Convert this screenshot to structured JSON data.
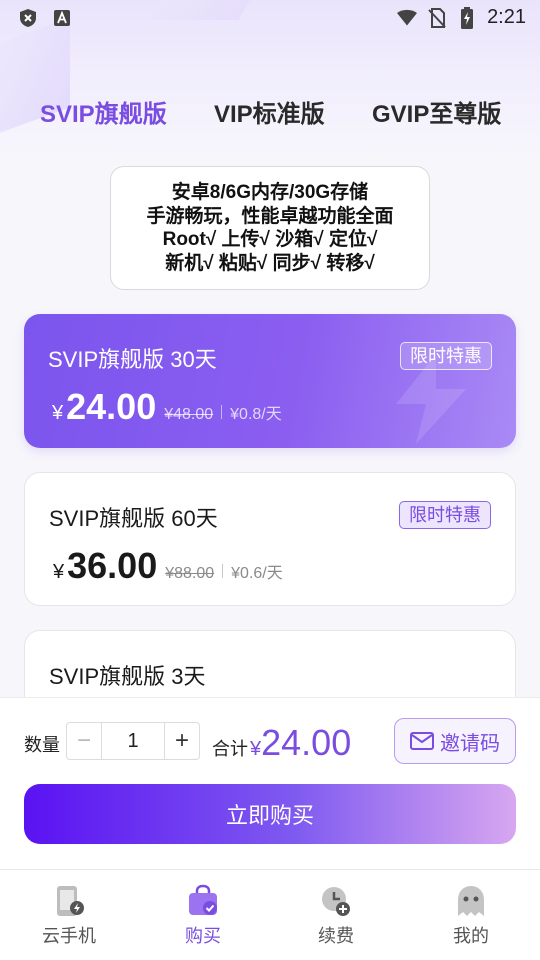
{
  "status_bar": {
    "time": "2:21",
    "left_icons": [
      "shield-x-icon",
      "font-a-icon"
    ],
    "right_icons": [
      "wifi-icon",
      "no-sim-icon",
      "battery-charging-icon"
    ]
  },
  "tabs": [
    {
      "label": "SVIP旗舰版",
      "active": true
    },
    {
      "label": "VIP标准版",
      "active": false
    },
    {
      "label": "GVIP至尊版",
      "active": false
    }
  ],
  "features": [
    "安卓8/6G内存/30G存储",
    "手游畅玩，性能卓越功能全面",
    "Root√ 上传√ 沙箱√ 定位√",
    "新机√ 粘贴√ 同步√ 转移√"
  ],
  "plans": [
    {
      "name": "SVIP旗舰版 30天",
      "tag": "限时特惠",
      "currency": "¥",
      "price": "24.00",
      "original": "¥48.00",
      "per_day": "¥0.8/天",
      "selected": true
    },
    {
      "name": "SVIP旗舰版 60天",
      "tag": "限时特惠",
      "currency": "¥",
      "price": "36.00",
      "original": "¥88.00",
      "per_day": "¥0.6/天",
      "selected": false
    },
    {
      "name": "SVIP旗舰版 3天"
    }
  ],
  "purchase": {
    "qty_label": "数量",
    "minus": "−",
    "qty_value": "1",
    "plus": "+",
    "total_label": "合计",
    "total_currency": "¥",
    "total_amount": "24.00",
    "invite_label": "邀请码",
    "buy_label": "立即购买"
  },
  "nav": [
    {
      "label": "云手机",
      "icon": "cloud-phone-icon",
      "active": false
    },
    {
      "label": "购买",
      "icon": "shopping-bag-icon",
      "active": true
    },
    {
      "label": "续费",
      "icon": "clock-plus-icon",
      "active": false
    },
    {
      "label": "我的",
      "icon": "ghost-icon",
      "active": false
    }
  ],
  "colors": {
    "accent": "#7a4ce0",
    "card_gradient_start": "#7b55ee",
    "button_gradient_start": "#5a12f2",
    "button_gradient_end": "#d7a7f0"
  }
}
